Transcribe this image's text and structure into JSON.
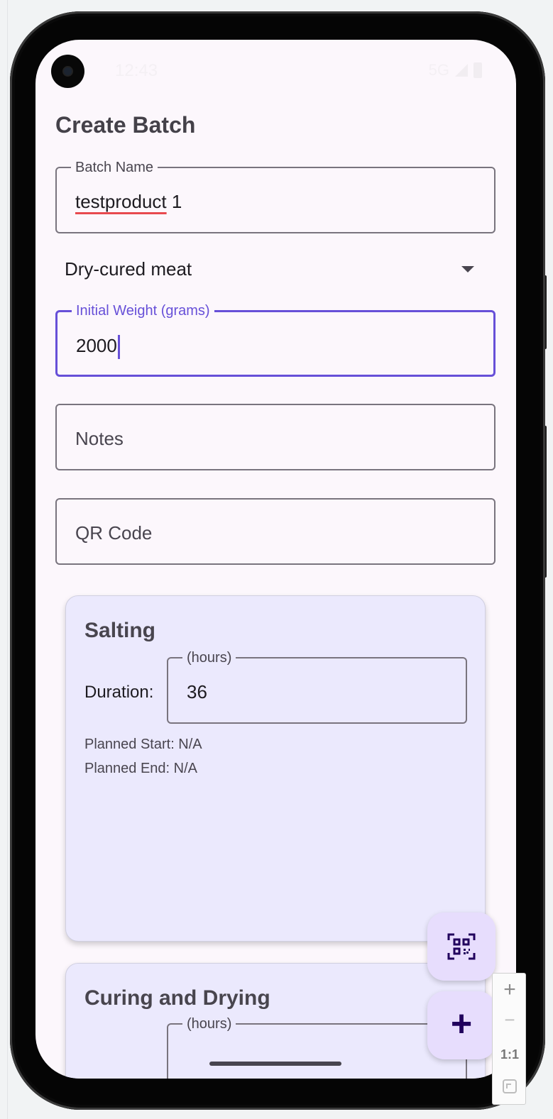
{
  "status_bar": {
    "time": "12:43",
    "network": "5G"
  },
  "page": {
    "title": "Create Batch"
  },
  "form": {
    "batch_name": {
      "label": "Batch Name",
      "value_misspelled": "testproduct",
      "value_rest": " 1"
    },
    "product_type": {
      "selected": "Dry-cured meat"
    },
    "initial_weight": {
      "label": "Initial Weight (grams)",
      "value": "2000"
    },
    "notes": {
      "placeholder": "Notes"
    },
    "qr_code": {
      "placeholder": "QR Code"
    }
  },
  "stages": [
    {
      "title": "Salting",
      "duration_label": "Duration:",
      "duration_field_label": "(hours)",
      "duration_value": "36",
      "planned_start": "Planned Start: N/A",
      "planned_end": "Planned End: N/A"
    },
    {
      "title": "Curing and Drying",
      "duration_field_label": "(hours)"
    }
  ],
  "fabs": {
    "scan_icon": "qr-scan-icon",
    "add_label": "+"
  },
  "zoom_controls": {
    "zoom_in": "+",
    "zoom_out": "−",
    "reset": "1:1"
  },
  "colors": {
    "accent": "#6750d8",
    "card_bg": "#ebe9fd",
    "fab_bg": "#e7ddfd",
    "screen_bg": "#fcf7fc"
  }
}
